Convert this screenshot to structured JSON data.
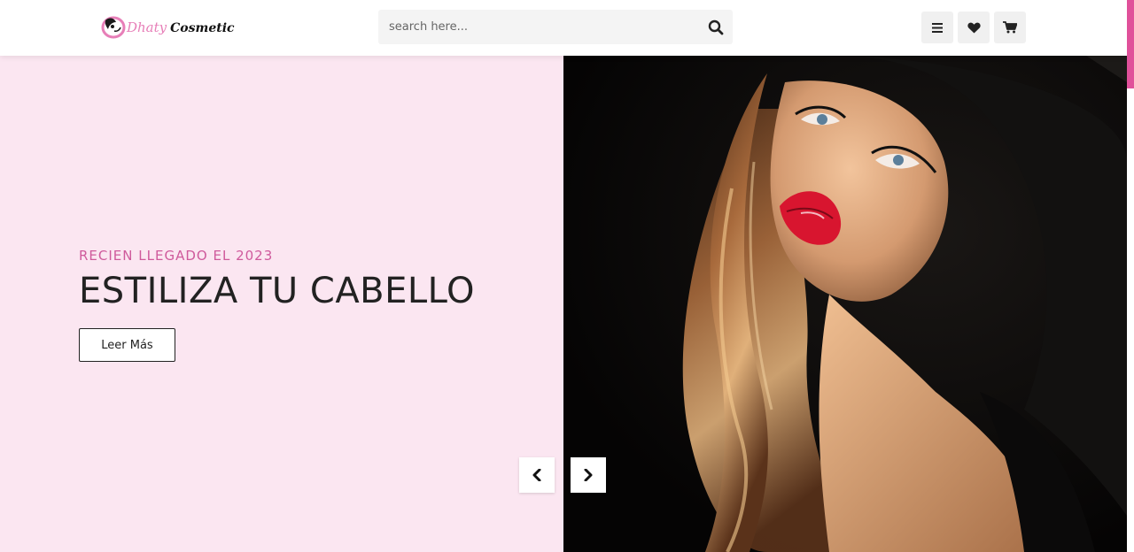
{
  "header": {
    "logo": {
      "word1": "Dhaty",
      "word2": "Cosmetic"
    },
    "search": {
      "placeholder": "search here...",
      "value": "",
      "icon": "search-icon"
    },
    "buttons": [
      {
        "icon": "menu-icon"
      },
      {
        "icon": "heart-icon"
      },
      {
        "icon": "cart-icon"
      }
    ]
  },
  "hero": {
    "kicker": "RECIEN LLEGADO EL 2023",
    "headline": "ESTILIZA TU CABELLO",
    "cta_label": "Leer Más",
    "image": "woman-portrait-red-lips-black-hat",
    "prev_icon": "chevron-left-icon",
    "next_icon": "chevron-right-icon"
  },
  "colors": {
    "brand_pink": "#cf5a9c",
    "hero_bg": "#fbe6f1",
    "accent": "#e0509a",
    "text_dark": "#222222"
  }
}
